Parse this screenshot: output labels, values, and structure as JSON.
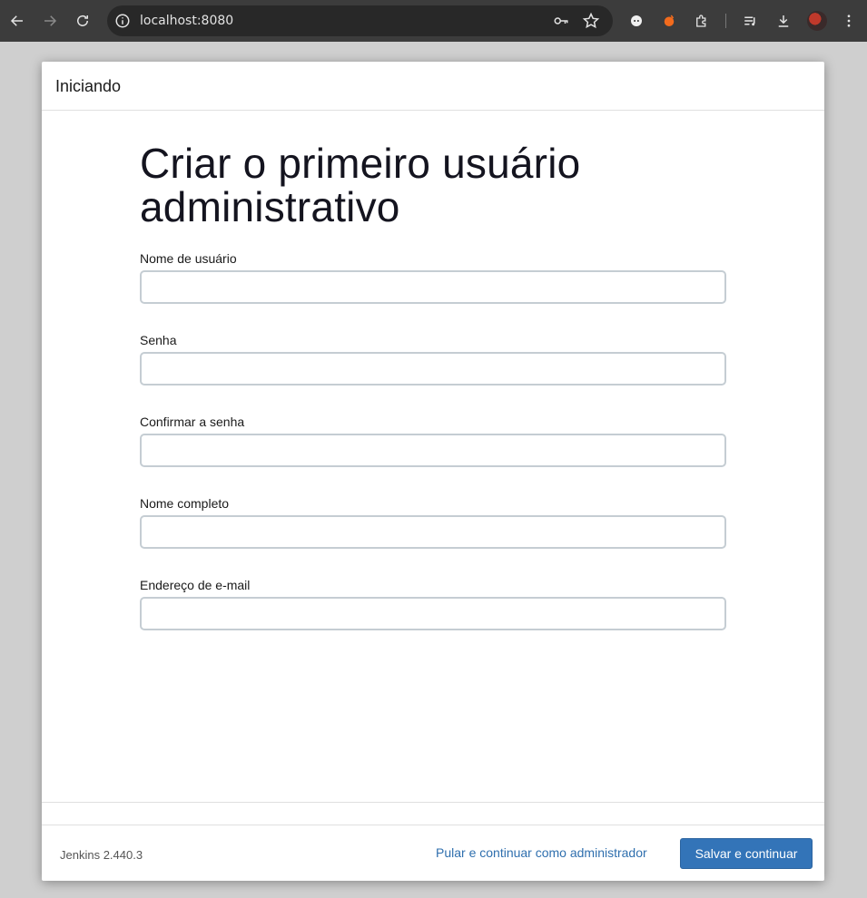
{
  "browser": {
    "url": "localhost:8080",
    "icons": [
      "back-arrow-icon",
      "forward-arrow-icon",
      "reload-icon",
      "site-info-icon",
      "password-key-icon",
      "bookmark-star-icon",
      "extension-icon",
      "extension-icon",
      "extensions-puzzle-icon",
      "reading-list-icon",
      "download-icon",
      "profile-avatar",
      "more-menu-icon"
    ]
  },
  "dialog": {
    "title": "Iniciando",
    "heading": "Criar o primeiro usuário administrativo",
    "fields": [
      {
        "label": "Nome de usuário",
        "value": "",
        "type": "text"
      },
      {
        "label": "Senha",
        "value": "",
        "type": "password"
      },
      {
        "label": "Confirmar a senha",
        "value": "",
        "type": "password"
      },
      {
        "label": "Nome completo",
        "value": "",
        "type": "text"
      },
      {
        "label": "Endereço de e-mail",
        "value": "",
        "type": "text"
      }
    ],
    "footer": {
      "version": "Jenkins 2.440.3",
      "skip_label": "Pular e continuar como administrador",
      "save_label": "Salvar e continuar"
    }
  },
  "colors": {
    "accent": "#3374b8",
    "link": "#2f6fae",
    "browser_toolbar": "#3c3c3c"
  }
}
